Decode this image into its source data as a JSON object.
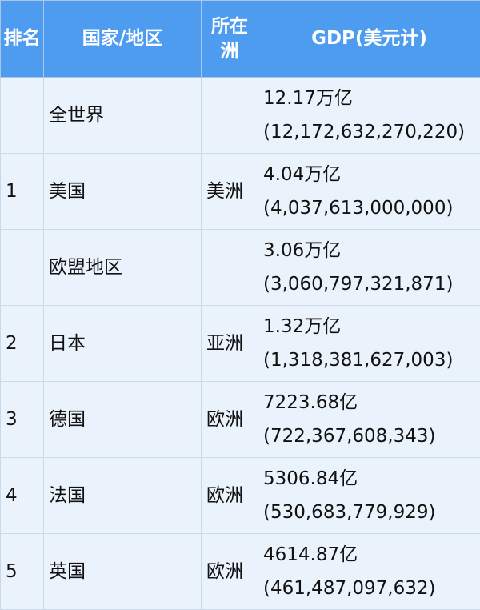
{
  "table": {
    "headers": {
      "rank": "排名",
      "country": "国家/地区",
      "continent": "所在洲",
      "gdp": "GDP(美元计)"
    },
    "rows": [
      {
        "rank": "",
        "country": "全世界",
        "continent": "",
        "gdp_short": "12.17万亿",
        "gdp_full": "(12,172,632,270,220)"
      },
      {
        "rank": "1",
        "country": "美国",
        "continent": "美洲",
        "gdp_short": "4.04万亿",
        "gdp_full": "(4,037,613,000,000)"
      },
      {
        "rank": "",
        "country": "欧盟地区",
        "continent": "",
        "gdp_short": "3.06万亿",
        "gdp_full": "(3,060,797,321,871)"
      },
      {
        "rank": "2",
        "country": "日本",
        "continent": "亚洲",
        "gdp_short": "1.32万亿",
        "gdp_full": "(1,318,381,627,003)"
      },
      {
        "rank": "3",
        "country": "德国",
        "continent": "欧洲",
        "gdp_short": "7223.68亿",
        "gdp_full": "(722,367,608,343)"
      },
      {
        "rank": "4",
        "country": "法国",
        "continent": "欧洲",
        "gdp_short": "5306.84亿",
        "gdp_full": "(530,683,779,929)"
      },
      {
        "rank": "5",
        "country": "英国",
        "continent": "欧洲",
        "gdp_short": "4614.87亿",
        "gdp_full": "(461,487,097,632)"
      }
    ]
  }
}
